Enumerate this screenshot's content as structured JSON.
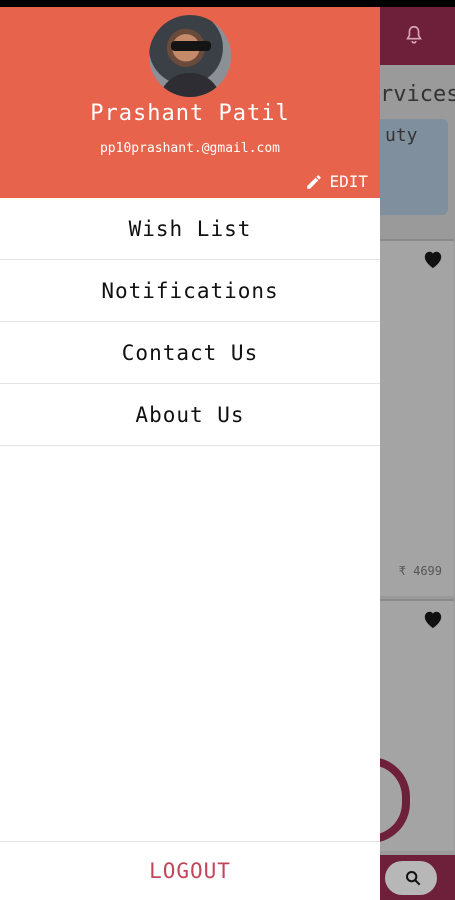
{
  "user": {
    "name": "Prashant Patil",
    "email": "pp10prashant.@gmail.com",
    "edit_label": "EDIT"
  },
  "menu": {
    "items": [
      {
        "label": "Wish List"
      },
      {
        "label": "Notifications"
      },
      {
        "label": "Contact Us"
      },
      {
        "label": "About Us"
      }
    ],
    "logout_label": "LOGOUT"
  },
  "background": {
    "services_text": "rvices",
    "card_text": "uty",
    "price": "₹ 4699"
  },
  "colors": {
    "drawer_header": "#e8634b",
    "app_bar": "#6e1f3a",
    "logout_text": "#c2465a"
  },
  "icons": [
    "bell-icon",
    "pencil-icon",
    "heart-icon",
    "search-icon"
  ]
}
